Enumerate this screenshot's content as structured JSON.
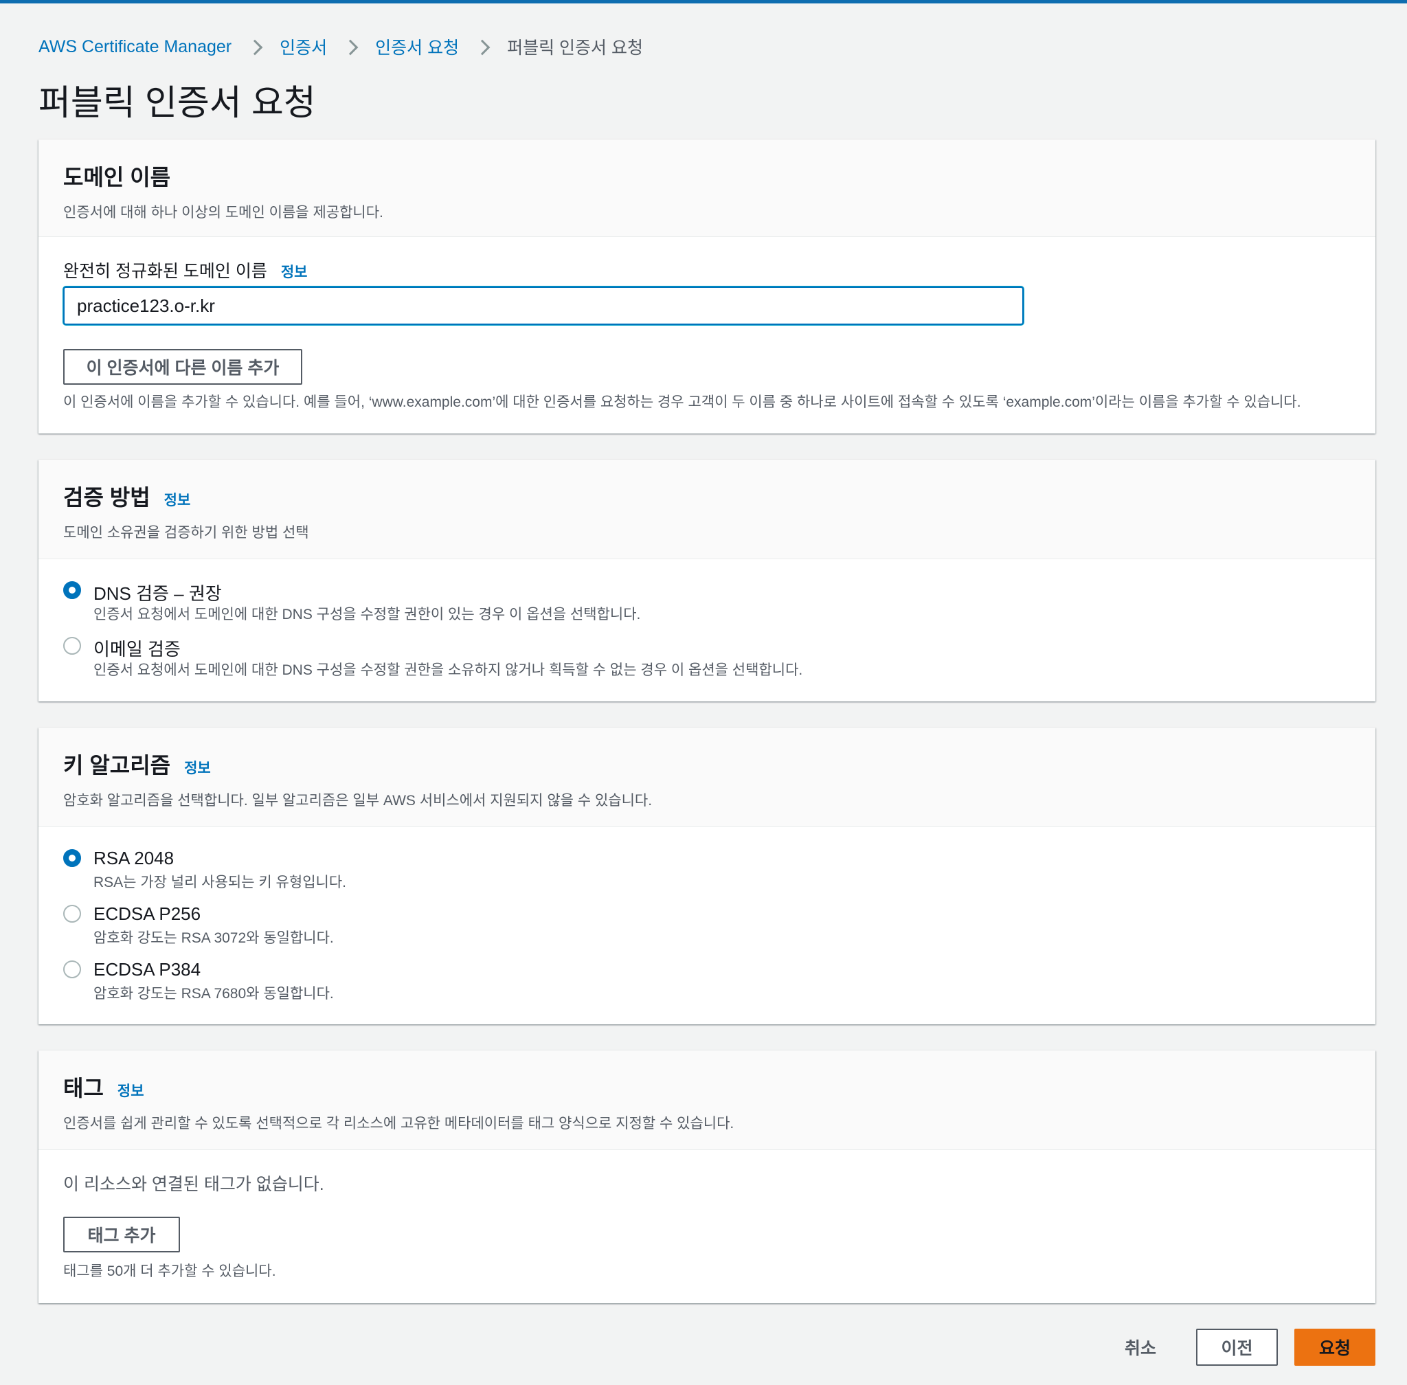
{
  "breadcrumb": {
    "items": [
      "AWS Certificate Manager",
      "인증서",
      "인증서 요청"
    ],
    "current": "퍼블릭 인증서 요청"
  },
  "page_title": "퍼블릭 인증서 요청",
  "info_label": "정보",
  "domain_panel": {
    "title": "도메인 이름",
    "description": "인증서에 대해 하나 이상의 도메인 이름을 제공합니다.",
    "field_label": "완전히 정규화된 도메인 이름",
    "field_value": "practice123.o-r.kr",
    "add_name_button": "이 인증서에 다른 이름 추가",
    "add_name_hint": "이 인증서에 이름을 추가할 수 있습니다. 예를 들어, ‘www.example.com’에 대한 인증서를 요청하는 경우 고객이 두 이름 중 하나로 사이트에 접속할 수 있도록 ‘example.com’이라는 이름을 추가할 수 있습니다."
  },
  "validation_panel": {
    "title": "검증 방법",
    "description": "도메인 소유권을 검증하기 위한 방법 선택",
    "options": [
      {
        "label": "DNS 검증 – 권장",
        "description": "인증서 요청에서 도메인에 대한 DNS 구성을 수정할 권한이 있는 경우 이 옵션을 선택합니다.",
        "selected": true
      },
      {
        "label": "이메일 검증",
        "description": "인증서 요청에서 도메인에 대한 DNS 구성을 수정할 권한을 소유하지 않거나 획득할 수 없는 경우 이 옵션을 선택합니다.",
        "selected": false
      }
    ]
  },
  "key_panel": {
    "title": "키 알고리즘",
    "description": "암호화 알고리즘을 선택합니다. 일부 알고리즘은 일부 AWS 서비스에서 지원되지 않을 수 있습니다.",
    "options": [
      {
        "label": "RSA 2048",
        "description": "RSA는 가장 널리 사용되는 키 유형입니다.",
        "selected": true
      },
      {
        "label": "ECDSA P256",
        "description": "암호화 강도는 RSA 3072와 동일합니다.",
        "selected": false
      },
      {
        "label": "ECDSA P384",
        "description": "암호화 강도는 RSA 7680와 동일합니다.",
        "selected": false
      }
    ]
  },
  "tags_panel": {
    "title": "태그",
    "description": "인증서를 쉽게 관리할 수 있도록 선택적으로 각 리소스에 고유한 메타데이터를 태그 양식으로 지정할 수 있습니다.",
    "empty_text": "이 리소스와 연결된 태그가 없습니다.",
    "add_tag_button": "태그 추가",
    "add_tag_hint": "태그를 50개 더 추가할 수 있습니다."
  },
  "footer": {
    "cancel": "취소",
    "previous": "이전",
    "submit": "요청"
  },
  "colors": {
    "accent": "#0073bb",
    "primary_button": "#ec7211",
    "top_bar": "#0f6db0"
  }
}
